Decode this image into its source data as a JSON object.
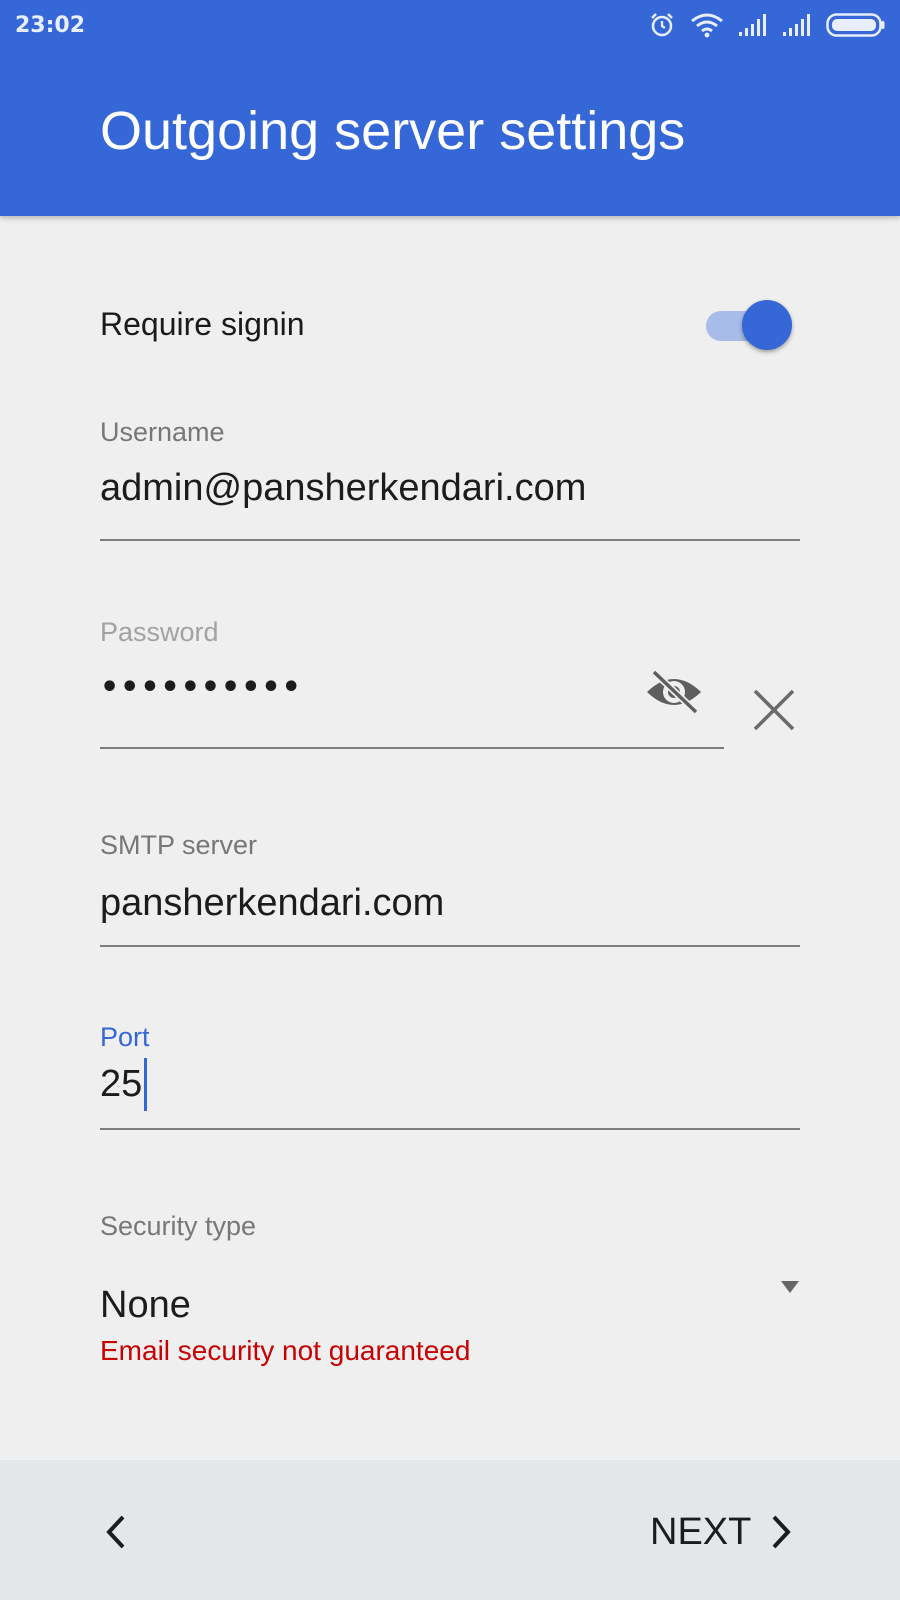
{
  "status_bar": {
    "time": "23:02",
    "icons": [
      "alarm-icon",
      "wifi-icon",
      "signal-icon",
      "signal-icon",
      "battery-icon"
    ]
  },
  "header": {
    "title": "Outgoing server settings",
    "background": "#3567d6"
  },
  "form": {
    "require_signin": {
      "label": "Require signin",
      "enabled": true
    },
    "username": {
      "label": "Username",
      "value": "admin@pansherkendari.com"
    },
    "password": {
      "label": "Password",
      "value": "••••••••••",
      "toggle_icon": "eye-off-icon",
      "clear_icon": "close-icon"
    },
    "smtp_server": {
      "label": "SMTP server",
      "value": "pansherkendari.com"
    },
    "port": {
      "label": "Port",
      "value": "25"
    },
    "security_type": {
      "label": "Security type",
      "value": "None",
      "warning": "Email security not guaranteed"
    }
  },
  "footer": {
    "back_icon": "chevron-left-icon",
    "next_label": "NEXT",
    "next_icon": "chevron-right-icon"
  },
  "colors": {
    "accent": "#3567d6",
    "error": "#c80000"
  }
}
